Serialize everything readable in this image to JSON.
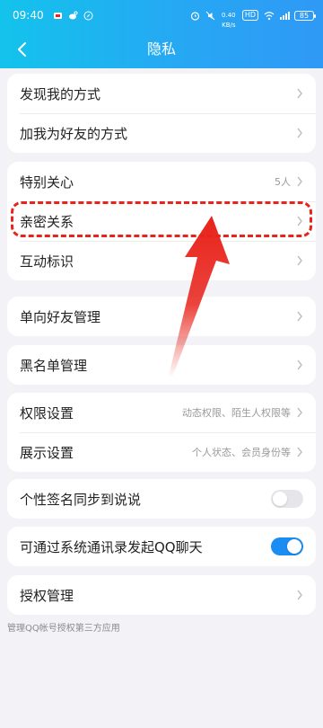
{
  "status_bar": {
    "time": "09:40",
    "network_speed": "0.40 KB/s",
    "signal": "HD",
    "battery": "85"
  },
  "nav": {
    "title": "隐私"
  },
  "sections": [
    {
      "rows": [
        {
          "label": "发现我的方式"
        },
        {
          "label": "加我为好友的方式"
        }
      ]
    },
    {
      "rows": [
        {
          "label": "特别关心",
          "value": "5人"
        },
        {
          "label": "亲密关系"
        },
        {
          "label": "互动标识"
        }
      ]
    },
    {
      "rows": [
        {
          "label": "单向好友管理"
        }
      ]
    },
    {
      "rows": [
        {
          "label": "黑名单管理"
        }
      ]
    },
    {
      "rows": [
        {
          "label": "权限设置",
          "value": "动态权限、陌生人权限等"
        },
        {
          "label": "展示设置",
          "value": "个人状态、会员身份等"
        }
      ]
    },
    {
      "rows": [
        {
          "label": "个性签名同步到说说",
          "toggle": false
        }
      ]
    },
    {
      "rows": [
        {
          "label": "可通过系统通讯录发起QQ聊天",
          "toggle": true
        }
      ]
    },
    {
      "rows": [
        {
          "label": "授权管理"
        }
      ]
    }
  ],
  "footnote": "管理QQ帐号授权第三方应用",
  "colors": {
    "header_start": "#13c3ec",
    "header_end": "#2f99f6",
    "toggle_on": "#1a8cf2",
    "annotation": "#e8231b"
  }
}
